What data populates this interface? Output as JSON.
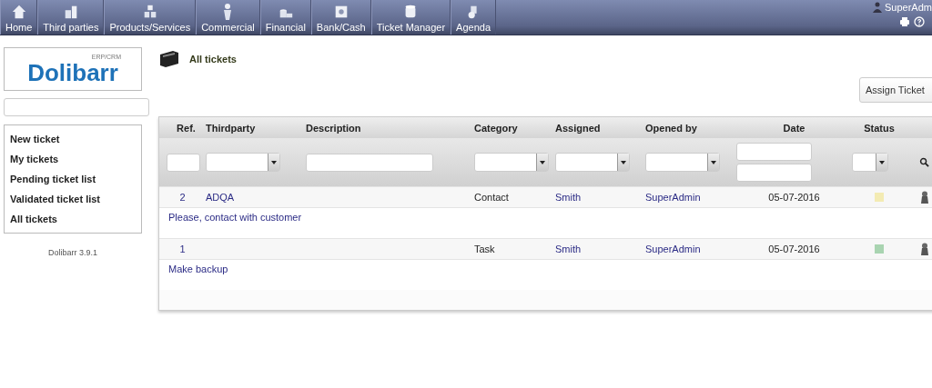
{
  "top_menu": [
    {
      "label": "Home"
    },
    {
      "label": "Third parties"
    },
    {
      "label": "Products/Services"
    },
    {
      "label": "Commercial"
    },
    {
      "label": "Financial"
    },
    {
      "label": "Bank/Cash"
    },
    {
      "label": "Ticket Manager"
    },
    {
      "label": "Agenda"
    }
  ],
  "user": {
    "name": "SuperAdm"
  },
  "logo": {
    "name": "Dolibarr",
    "tagline": "ERP/CRM"
  },
  "sidebar": {
    "items": [
      "New ticket",
      "My tickets",
      "Pending ticket list",
      "Validated ticket list",
      "All tickets"
    ],
    "version": "Dolibarr 3.9.1"
  },
  "page_title": "All tickets",
  "assign_button": "Assign Ticket",
  "table": {
    "columns": [
      {
        "label": "Ref.",
        "kind": "text"
      },
      {
        "label": "Thirdparty",
        "kind": "select"
      },
      {
        "label": "Description",
        "kind": "text"
      },
      {
        "label": "Category",
        "kind": "select"
      },
      {
        "label": "Assigned",
        "kind": "select"
      },
      {
        "label": "Opened by",
        "kind": "select"
      },
      {
        "label": "Date",
        "kind": "daterange"
      },
      {
        "label": "Status",
        "kind": "select"
      },
      {
        "kind": "search"
      }
    ],
    "rows": [
      {
        "ref": "2",
        "thirdparty": "ADQA",
        "category": "Contact",
        "assigned": "Smith",
        "opened_by": "SuperAdmin",
        "date": "05-07-2016",
        "color": "#f3ebb3",
        "description": "Please, contact with customer"
      },
      {
        "ref": "1",
        "category": "Task",
        "assigned": "Smith",
        "opened_by": "SuperAdmin",
        "date": "05-07-2016",
        "color": "#a9d4b1",
        "description": "Make backup"
      }
    ]
  }
}
